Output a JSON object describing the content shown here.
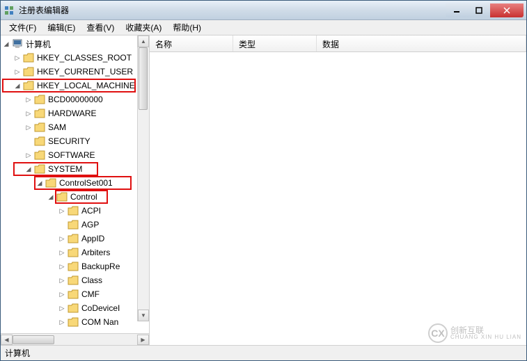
{
  "window": {
    "title": "注册表编辑器"
  },
  "menu": {
    "file": "文件(F)",
    "edit": "编辑(E)",
    "view": "查看(V)",
    "favorites": "收藏夹(A)",
    "help": "帮助(H)"
  },
  "tree": {
    "root": "计算机",
    "hkcr": "HKEY_CLASSES_ROOT",
    "hkcu": "HKEY_CURRENT_USER",
    "hklm": "HKEY_LOCAL_MACHINE",
    "bcd": "BCD00000000",
    "hardware": "HARDWARE",
    "sam": "SAM",
    "security": "SECURITY",
    "software": "SOFTWARE",
    "system": "SYSTEM",
    "controlset001": "ControlSet001",
    "control": "Control",
    "acpi": "ACPI",
    "agp": "AGP",
    "appid": "AppID",
    "arbiters": "Arbiters",
    "backupre": "BackupRe",
    "class": "Class",
    "cmf": "CMF",
    "codevicei": "CoDeviceI",
    "comnan": "COM Nan"
  },
  "columns": {
    "name": "名称",
    "type": "类型",
    "data": "数据"
  },
  "status": {
    "path": "计算机"
  },
  "watermark": {
    "brand": "创新互联",
    "sub": "CHUANG XIN HU LIAN"
  }
}
